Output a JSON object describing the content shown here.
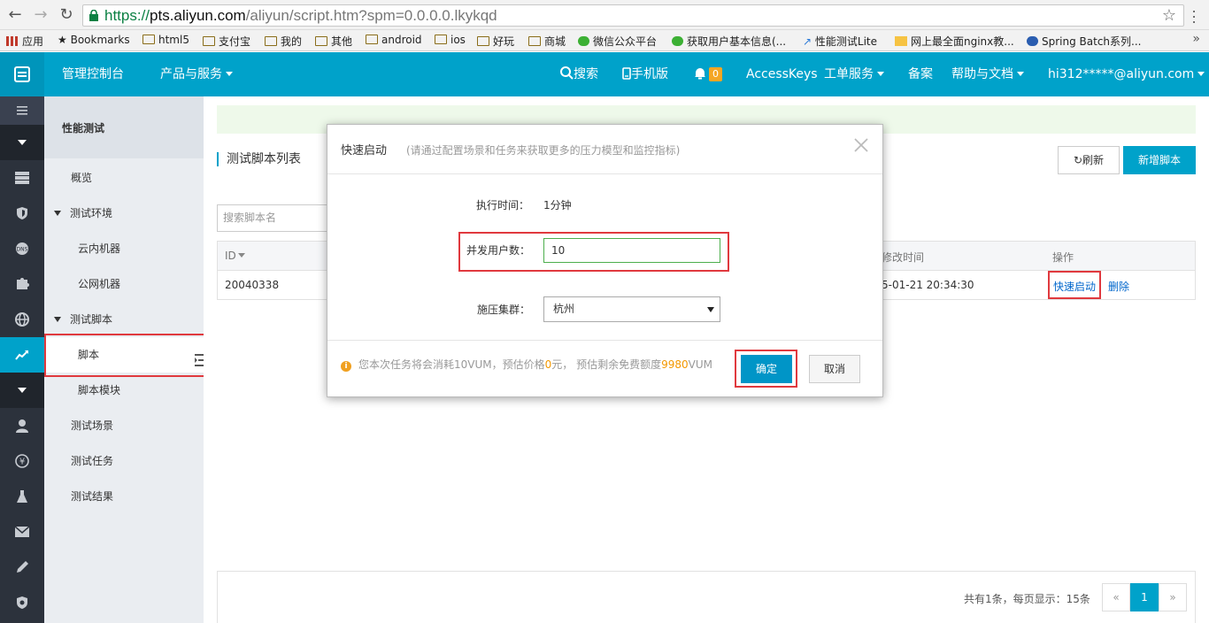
{
  "browser": {
    "url_scheme": "https://",
    "url_host": "pts.aliyun.com",
    "url_path": "/aliyun/script.htm?spm=0.0.0.0.lkykqd",
    "bookmarks": [
      "应用",
      "Bookmarks",
      "html5",
      "支付宝",
      "我的",
      "其他",
      "android",
      "ios",
      "好玩",
      "商城",
      "微信公众平台",
      "获取用户基本信息(...",
      "性能测试Lite",
      "网上最全面nginx教...",
      "Spring Batch系列..."
    ]
  },
  "header": {
    "console": "管理控制台",
    "products": "产品与服务",
    "search": "搜索",
    "mobile": "手机版",
    "notification_count": "0",
    "access_keys": "AccessKeys",
    "tickets": "工单服务",
    "filing": "备案",
    "help": "帮助与文档",
    "account": "hi312*****@aliyun.com"
  },
  "sidebar": {
    "title": "性能测试",
    "items": {
      "overview": "概览",
      "env": "测试环境",
      "cloud_machine": "云内机器",
      "public_machine": "公网机器",
      "test_script": "测试脚本",
      "script": "脚本",
      "script_module": "脚本模块",
      "scenario": "测试场景",
      "task": "测试任务",
      "result": "测试结果"
    }
  },
  "main": {
    "title": "测试脚本列表",
    "refresh": "刷新",
    "new_script": "新增脚本",
    "search_placeholder": "搜索脚本名",
    "columns": {
      "id": "ID",
      "modified": "修改时间",
      "actions": "操作"
    },
    "rows": [
      {
        "id": "20040338",
        "modified": "5-01-21 20:34:30",
        "quick_start": "快速启动",
        "delete": "删除"
      }
    ],
    "pager_info": "共有1条，每页显示：15条",
    "pager": {
      "prev": "«",
      "current": "1",
      "next": "»"
    }
  },
  "modal": {
    "title": "快速启动",
    "subtitle": "(请通过配置场景和任务来获取更多的压力模型和监控指标)",
    "exec_time_label": "执行时间：",
    "exec_time_value": "1分钟",
    "users_label": "并发用户数：",
    "users_value": "10",
    "cluster_label": "施压集群：",
    "cluster_value": "杭州",
    "info_prefix": "您本次任务将会消耗10VUM，预估价格",
    "info_price": "0",
    "info_middle": "元，  预估剩余免费额度",
    "info_quota": "9980",
    "info_suffix": "VUM",
    "ok": "确定",
    "cancel": "取消"
  },
  "colors": {
    "brand": "#00a2ca",
    "highlight": "#e0393e",
    "rail": "#2c323c"
  }
}
